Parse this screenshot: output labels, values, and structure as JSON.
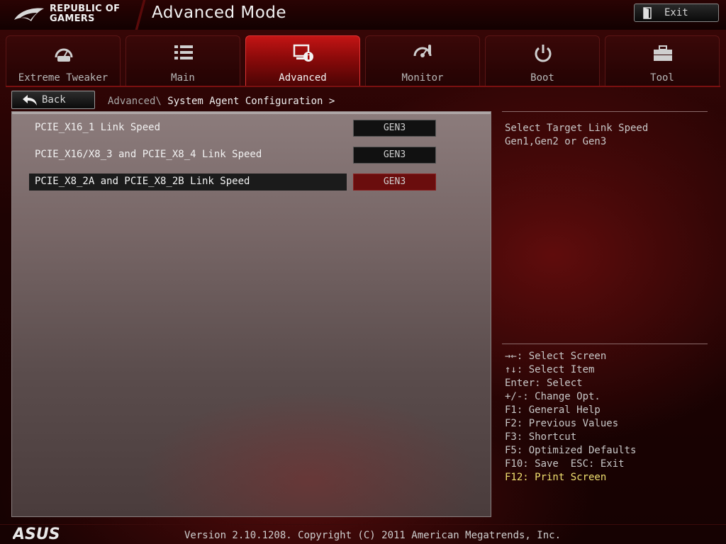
{
  "header": {
    "logo_line1": "REPUBLIC OF",
    "logo_line2": "GAMERS",
    "title": "Advanced Mode",
    "exit_label": "Exit"
  },
  "tabs": [
    {
      "label": "Extreme Tweaker",
      "icon": "gauge-icon",
      "active": false
    },
    {
      "label": "Main",
      "icon": "list-icon",
      "active": false
    },
    {
      "label": "Advanced",
      "icon": "advanced-info-icon",
      "active": true
    },
    {
      "label": "Monitor",
      "icon": "monitor-gauge-icon",
      "active": false
    },
    {
      "label": "Boot",
      "icon": "power-icon",
      "active": false
    },
    {
      "label": "Tool",
      "icon": "toolbox-icon",
      "active": false
    }
  ],
  "nav": {
    "back_label": "Back",
    "breadcrumb_root": "Advanced\\",
    "breadcrumb_page": " System Agent Configuration >"
  },
  "settings": [
    {
      "label": "PCIE_X16_1 Link Speed",
      "value": "GEN3",
      "selected": false
    },
    {
      "label": "PCIE_X16/X8_3 and PCIE_X8_4 Link Speed",
      "value": "GEN3",
      "selected": false
    },
    {
      "label": "PCIE_X8_2A and PCIE_X8_2B Link Speed",
      "value": "GEN3",
      "selected": true
    }
  ],
  "help": {
    "text": "Select Target Link Speed Gen1,Gen2 or Gen3"
  },
  "keys": [
    "→←: Select Screen",
    "↑↓: Select Item",
    "Enter: Select",
    "+/-: Change Opt.",
    "F1: General Help",
    "F2: Previous Values",
    "F3: Shortcut",
    "F5: Optimized Defaults",
    "F10: Save  ESC: Exit",
    "F12: Print Screen"
  ],
  "footer": {
    "brand": "ASUS",
    "version": "Version 2.10.1208. Copyright (C) 2011 American Megatrends, Inc."
  },
  "colors": {
    "accent_red": "#c31414",
    "selected_value": "#6a0d0d",
    "highlight_key": "#f0e070"
  }
}
